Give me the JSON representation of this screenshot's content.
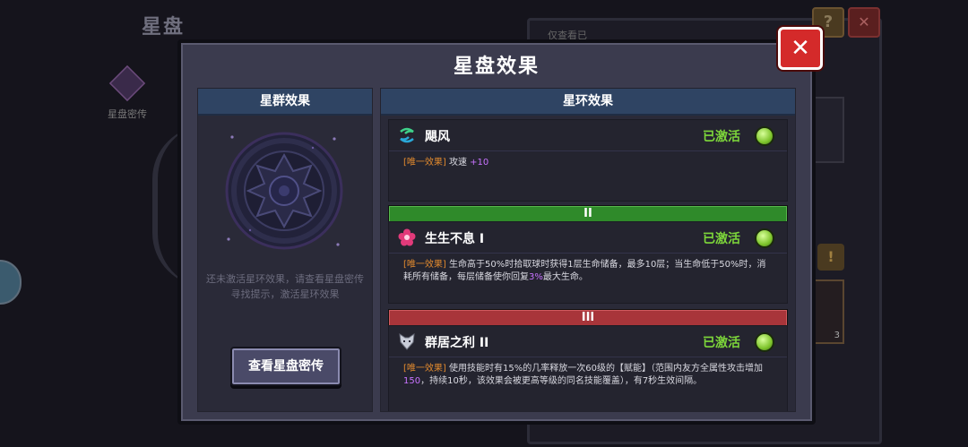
{
  "background": {
    "title": "星盘",
    "side_label": "星盘密传",
    "panel_tab": "仅查看已",
    "help_glyph": "?",
    "close_glyph": "✕",
    "badge_glyph": "!",
    "item_count": "3"
  },
  "dialog": {
    "title": "星盘效果",
    "close_glyph": "✕",
    "left": {
      "header": "星群效果",
      "hint": "还未激活星环效果，请查看星盘密传寻找提示，激活星环效果",
      "button": "查看星盘密传"
    },
    "right": {
      "header": "星环效果",
      "effects": [
        {
          "name": "飓风",
          "status": "已激活",
          "tag": "[唯一效果]",
          "desc_a": " 攻速 ",
          "num_a": "+10",
          "desc_b": "",
          "num_b": "",
          "desc_c": "",
          "icon": "whirlwind-icon"
        },
        {
          "name": "生生不息 I",
          "status": "已激活",
          "tag": "[唯一效果]",
          "desc_a": " 生命高于50%时拾取球时获得1层生命储备，最多10层；当生命低于50%时，消耗所有储备，每层储备使你回复",
          "num_a": "3%",
          "desc_b": "最大生命。",
          "num_b": "",
          "desc_c": "",
          "icon": "flower-icon"
        },
        {
          "name": "群居之利 II",
          "status": "已激活",
          "tag": "[唯一效果]",
          "desc_a": " 使用技能时有15%的几率释放一次60级的【赋能】（范围内友方全属性攻击增加",
          "num_a": "150",
          "desc_b": "，持续10秒，该效果会被更高等级的同名技能覆盖），有7秒生效间隔。",
          "num_b": "",
          "desc_c": "",
          "icon": "wolf-icon"
        }
      ],
      "dividers": [
        "II",
        "III"
      ]
    }
  },
  "colors": {
    "active": "#7dd63a",
    "tag": "#e0892e",
    "number": "#c873ff",
    "header": "#2f4463",
    "close": "#d42a2a"
  }
}
